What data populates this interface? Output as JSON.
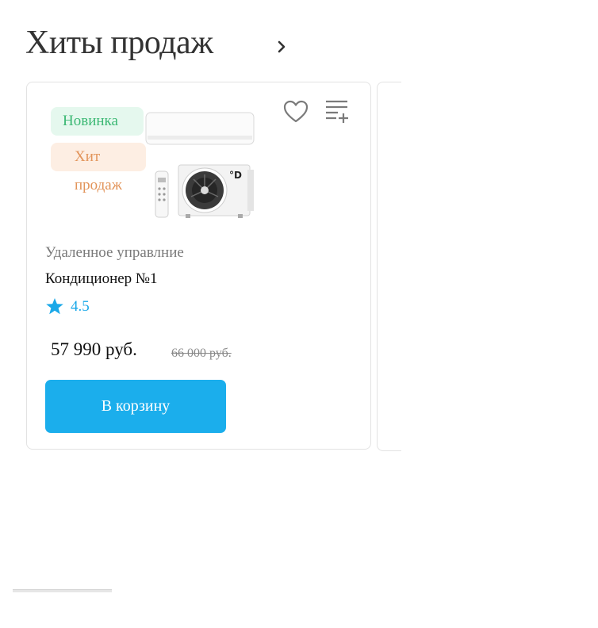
{
  "section": {
    "title": "Хиты продаж"
  },
  "product": {
    "badges": {
      "new": "Новинка",
      "hit": "Хит продаж"
    },
    "subtitle": "Удаленное управлние",
    "name": "Кондиционер №1",
    "rating": "4.5",
    "price": "57 990 руб.",
    "old_price": "66 000 руб.",
    "cart_label": "В корзину"
  },
  "colors": {
    "accent": "#1baeec",
    "star": "#1aa8e8",
    "badge_new_bg": "#e5f8ee",
    "badge_new_text": "#3cb874",
    "badge_hit_bg": "#fdeee3",
    "badge_hit_text": "#e2945a"
  },
  "icons": {
    "section_link": "chevron-right-icon",
    "favorite": "heart-icon",
    "compare": "list-add-icon",
    "rating": "star-icon"
  }
}
